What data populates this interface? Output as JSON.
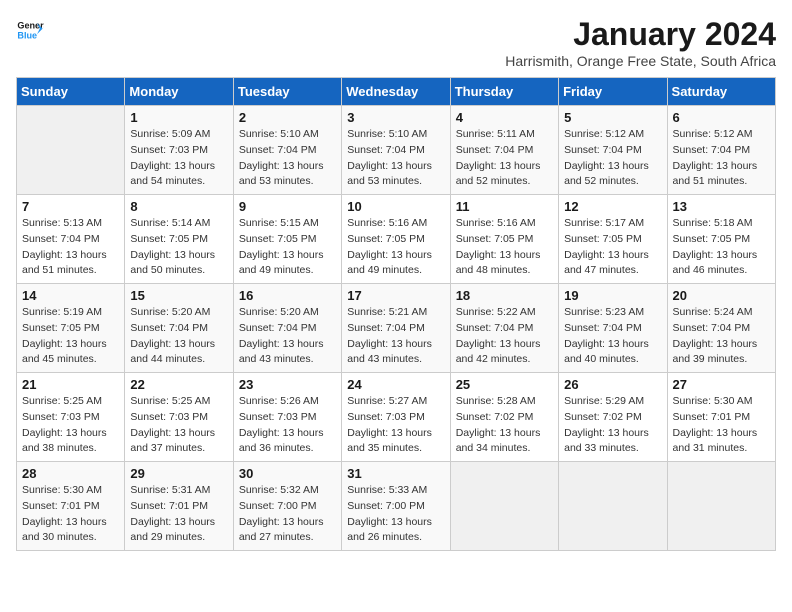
{
  "logo": {
    "line1": "General",
    "line2": "Blue"
  },
  "title": "January 2024",
  "location": "Harrismith, Orange Free State, South Africa",
  "days_header": [
    "Sunday",
    "Monday",
    "Tuesday",
    "Wednesday",
    "Thursday",
    "Friday",
    "Saturday"
  ],
  "weeks": [
    [
      {
        "day": "",
        "info": ""
      },
      {
        "day": "1",
        "info": "Sunrise: 5:09 AM\nSunset: 7:03 PM\nDaylight: 13 hours\nand 54 minutes."
      },
      {
        "day": "2",
        "info": "Sunrise: 5:10 AM\nSunset: 7:04 PM\nDaylight: 13 hours\nand 53 minutes."
      },
      {
        "day": "3",
        "info": "Sunrise: 5:10 AM\nSunset: 7:04 PM\nDaylight: 13 hours\nand 53 minutes."
      },
      {
        "day": "4",
        "info": "Sunrise: 5:11 AM\nSunset: 7:04 PM\nDaylight: 13 hours\nand 52 minutes."
      },
      {
        "day": "5",
        "info": "Sunrise: 5:12 AM\nSunset: 7:04 PM\nDaylight: 13 hours\nand 52 minutes."
      },
      {
        "day": "6",
        "info": "Sunrise: 5:12 AM\nSunset: 7:04 PM\nDaylight: 13 hours\nand 51 minutes."
      }
    ],
    [
      {
        "day": "7",
        "info": "Sunrise: 5:13 AM\nSunset: 7:04 PM\nDaylight: 13 hours\nand 51 minutes."
      },
      {
        "day": "8",
        "info": "Sunrise: 5:14 AM\nSunset: 7:05 PM\nDaylight: 13 hours\nand 50 minutes."
      },
      {
        "day": "9",
        "info": "Sunrise: 5:15 AM\nSunset: 7:05 PM\nDaylight: 13 hours\nand 49 minutes."
      },
      {
        "day": "10",
        "info": "Sunrise: 5:16 AM\nSunset: 7:05 PM\nDaylight: 13 hours\nand 49 minutes."
      },
      {
        "day": "11",
        "info": "Sunrise: 5:16 AM\nSunset: 7:05 PM\nDaylight: 13 hours\nand 48 minutes."
      },
      {
        "day": "12",
        "info": "Sunrise: 5:17 AM\nSunset: 7:05 PM\nDaylight: 13 hours\nand 47 minutes."
      },
      {
        "day": "13",
        "info": "Sunrise: 5:18 AM\nSunset: 7:05 PM\nDaylight: 13 hours\nand 46 minutes."
      }
    ],
    [
      {
        "day": "14",
        "info": "Sunrise: 5:19 AM\nSunset: 7:05 PM\nDaylight: 13 hours\nand 45 minutes."
      },
      {
        "day": "15",
        "info": "Sunrise: 5:20 AM\nSunset: 7:04 PM\nDaylight: 13 hours\nand 44 minutes."
      },
      {
        "day": "16",
        "info": "Sunrise: 5:20 AM\nSunset: 7:04 PM\nDaylight: 13 hours\nand 43 minutes."
      },
      {
        "day": "17",
        "info": "Sunrise: 5:21 AM\nSunset: 7:04 PM\nDaylight: 13 hours\nand 43 minutes."
      },
      {
        "day": "18",
        "info": "Sunrise: 5:22 AM\nSunset: 7:04 PM\nDaylight: 13 hours\nand 42 minutes."
      },
      {
        "day": "19",
        "info": "Sunrise: 5:23 AM\nSunset: 7:04 PM\nDaylight: 13 hours\nand 40 minutes."
      },
      {
        "day": "20",
        "info": "Sunrise: 5:24 AM\nSunset: 7:04 PM\nDaylight: 13 hours\nand 39 minutes."
      }
    ],
    [
      {
        "day": "21",
        "info": "Sunrise: 5:25 AM\nSunset: 7:03 PM\nDaylight: 13 hours\nand 38 minutes."
      },
      {
        "day": "22",
        "info": "Sunrise: 5:25 AM\nSunset: 7:03 PM\nDaylight: 13 hours\nand 37 minutes."
      },
      {
        "day": "23",
        "info": "Sunrise: 5:26 AM\nSunset: 7:03 PM\nDaylight: 13 hours\nand 36 minutes."
      },
      {
        "day": "24",
        "info": "Sunrise: 5:27 AM\nSunset: 7:03 PM\nDaylight: 13 hours\nand 35 minutes."
      },
      {
        "day": "25",
        "info": "Sunrise: 5:28 AM\nSunset: 7:02 PM\nDaylight: 13 hours\nand 34 minutes."
      },
      {
        "day": "26",
        "info": "Sunrise: 5:29 AM\nSunset: 7:02 PM\nDaylight: 13 hours\nand 33 minutes."
      },
      {
        "day": "27",
        "info": "Sunrise: 5:30 AM\nSunset: 7:01 PM\nDaylight: 13 hours\nand 31 minutes."
      }
    ],
    [
      {
        "day": "28",
        "info": "Sunrise: 5:30 AM\nSunset: 7:01 PM\nDaylight: 13 hours\nand 30 minutes."
      },
      {
        "day": "29",
        "info": "Sunrise: 5:31 AM\nSunset: 7:01 PM\nDaylight: 13 hours\nand 29 minutes."
      },
      {
        "day": "30",
        "info": "Sunrise: 5:32 AM\nSunset: 7:00 PM\nDaylight: 13 hours\nand 27 minutes."
      },
      {
        "day": "31",
        "info": "Sunrise: 5:33 AM\nSunset: 7:00 PM\nDaylight: 13 hours\nand 26 minutes."
      },
      {
        "day": "",
        "info": ""
      },
      {
        "day": "",
        "info": ""
      },
      {
        "day": "",
        "info": ""
      }
    ]
  ]
}
